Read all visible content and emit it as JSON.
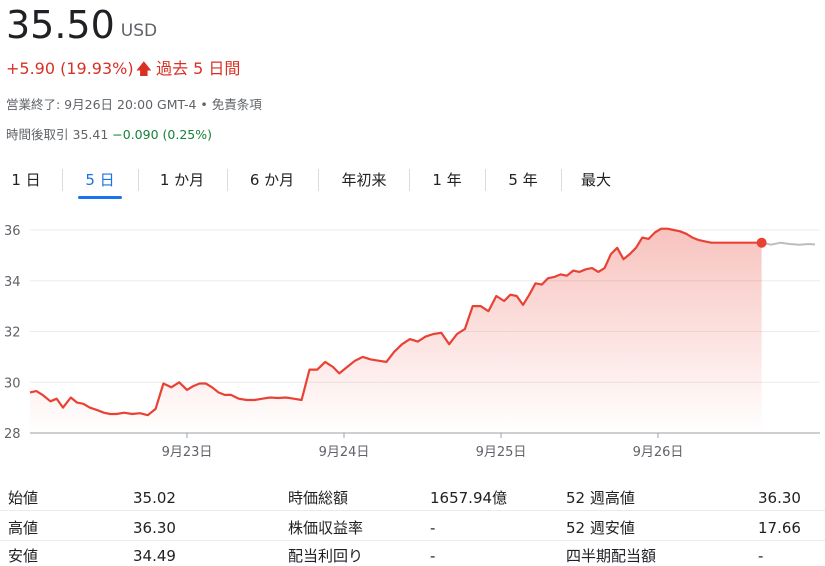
{
  "header": {
    "price": "35.50",
    "currency": "USD",
    "change": "+5.90 (19.93%)",
    "change_period": "過去 5 日間",
    "close_info": "営業終了: 9月26日 20:00 GMT-4 • 免責条項",
    "after_hours_label": "時間後取引",
    "after_hours_price": "35.41",
    "after_hours_change": "−0.090 (0.25%)"
  },
  "tabs": [
    {
      "label": "1 日"
    },
    {
      "label": "5 日"
    },
    {
      "label": "1 か月"
    },
    {
      "label": "6 か月"
    },
    {
      "label": "年初来"
    },
    {
      "label": "1 年"
    },
    {
      "label": "5 年"
    },
    {
      "label": "最大"
    }
  ],
  "active_tab": "5 日",
  "colors": {
    "accent": "#1a73e8",
    "down_red": "#d93025",
    "line_red": "#e84235",
    "green": "#188038",
    "after_hours_gray": "#bdbdbd"
  },
  "chart_data": {
    "type": "line",
    "ylim": [
      28,
      36
    ],
    "yticks": [
      28,
      30,
      32,
      34,
      36
    ],
    "xlabels": [
      "9月23日",
      "9月24日",
      "9月25日",
      "9月26日"
    ],
    "x_domain": [
      0,
      5
    ],
    "xlabel_positions": [
      1,
      2,
      3,
      4
    ],
    "series": [
      {
        "x": [
          0,
          0.04,
          0.08,
          0.13,
          0.17,
          0.21,
          0.26,
          0.3,
          0.34,
          0.38,
          0.43,
          0.47,
          0.51,
          0.55,
          0.6,
          0.65,
          0.7,
          0.75,
          0.8,
          0.85,
          0.9,
          0.95,
          1.0,
          1.04,
          1.08,
          1.12,
          1.16,
          1.2,
          1.24,
          1.28,
          1.33,
          1.38,
          1.43,
          1.48,
          1.53,
          1.58,
          1.63,
          1.68,
          1.73,
          1.78,
          1.83,
          1.88,
          1.93,
          1.97,
          2.02,
          2.07,
          2.12,
          2.17,
          2.22,
          2.27,
          2.32,
          2.37,
          2.42,
          2.47,
          2.52,
          2.57,
          2.62,
          2.67,
          2.72,
          2.77,
          2.82,
          2.87,
          2.92,
          2.97,
          3.02,
          3.06,
          3.1,
          3.14,
          3.18,
          3.22,
          3.26,
          3.3,
          3.34,
          3.38,
          3.42,
          3.46,
          3.5,
          3.54,
          3.58,
          3.62,
          3.66,
          3.7,
          3.74,
          3.78,
          3.82,
          3.86,
          3.9,
          3.94,
          3.98,
          4.02,
          4.06,
          4.1,
          4.14,
          4.18,
          4.22,
          4.26,
          4.3,
          4.34,
          4.38,
          4.42,
          4.46,
          4.5,
          4.54,
          4.58,
          4.62,
          4.66
        ],
        "y": [
          29.6,
          29.65,
          29.5,
          29.25,
          29.35,
          29.0,
          29.4,
          29.2,
          29.15,
          29.0,
          28.9,
          28.8,
          28.75,
          28.75,
          28.8,
          28.75,
          28.78,
          28.7,
          28.95,
          29.95,
          29.8,
          30.0,
          29.7,
          29.85,
          29.95,
          29.95,
          29.8,
          29.6,
          29.5,
          29.5,
          29.35,
          29.3,
          29.3,
          29.35,
          29.4,
          29.38,
          29.4,
          29.35,
          29.3,
          30.5,
          30.5,
          30.8,
          30.6,
          30.35,
          30.6,
          30.85,
          31.0,
          30.9,
          30.85,
          30.8,
          31.2,
          31.5,
          31.7,
          31.6,
          31.8,
          31.9,
          31.95,
          31.5,
          31.9,
          32.1,
          33.0,
          33.0,
          32.8,
          33.4,
          33.2,
          33.45,
          33.4,
          33.05,
          33.45,
          33.9,
          33.85,
          34.1,
          34.15,
          34.25,
          34.2,
          34.4,
          34.35,
          34.45,
          34.5,
          34.35,
          34.5,
          35.05,
          35.3,
          34.85,
          35.05,
          35.3,
          35.7,
          35.65,
          35.9,
          36.05,
          36.05,
          36.0,
          35.95,
          35.85,
          35.7,
          35.6,
          35.55,
          35.5,
          35.5,
          35.5,
          35.5,
          35.5,
          35.5,
          35.5,
          35.5,
          35.5
        ],
        "color": "#e84235"
      },
      {
        "x": [
          4.66,
          4.72,
          4.78,
          4.84,
          4.9,
          4.96,
          5.0
        ],
        "y": [
          35.5,
          35.42,
          35.5,
          35.45,
          35.42,
          35.45,
          35.43
        ],
        "color": "#bdbdbd"
      }
    ],
    "grid": true
  },
  "stats": [
    {
      "label": "始値",
      "value": "35.02"
    },
    {
      "label": "高値",
      "value": "36.30"
    },
    {
      "label": "安値",
      "value": "34.49"
    },
    {
      "label": "時価総額",
      "value": "1657.94億"
    },
    {
      "label": "株価収益率",
      "value": "-"
    },
    {
      "label": "配当利回り",
      "value": "-"
    },
    {
      "label": "52 週高値",
      "value": "36.30"
    },
    {
      "label": "52 週安値",
      "value": "17.66"
    },
    {
      "label": "四半期配当額",
      "value": "-"
    }
  ]
}
